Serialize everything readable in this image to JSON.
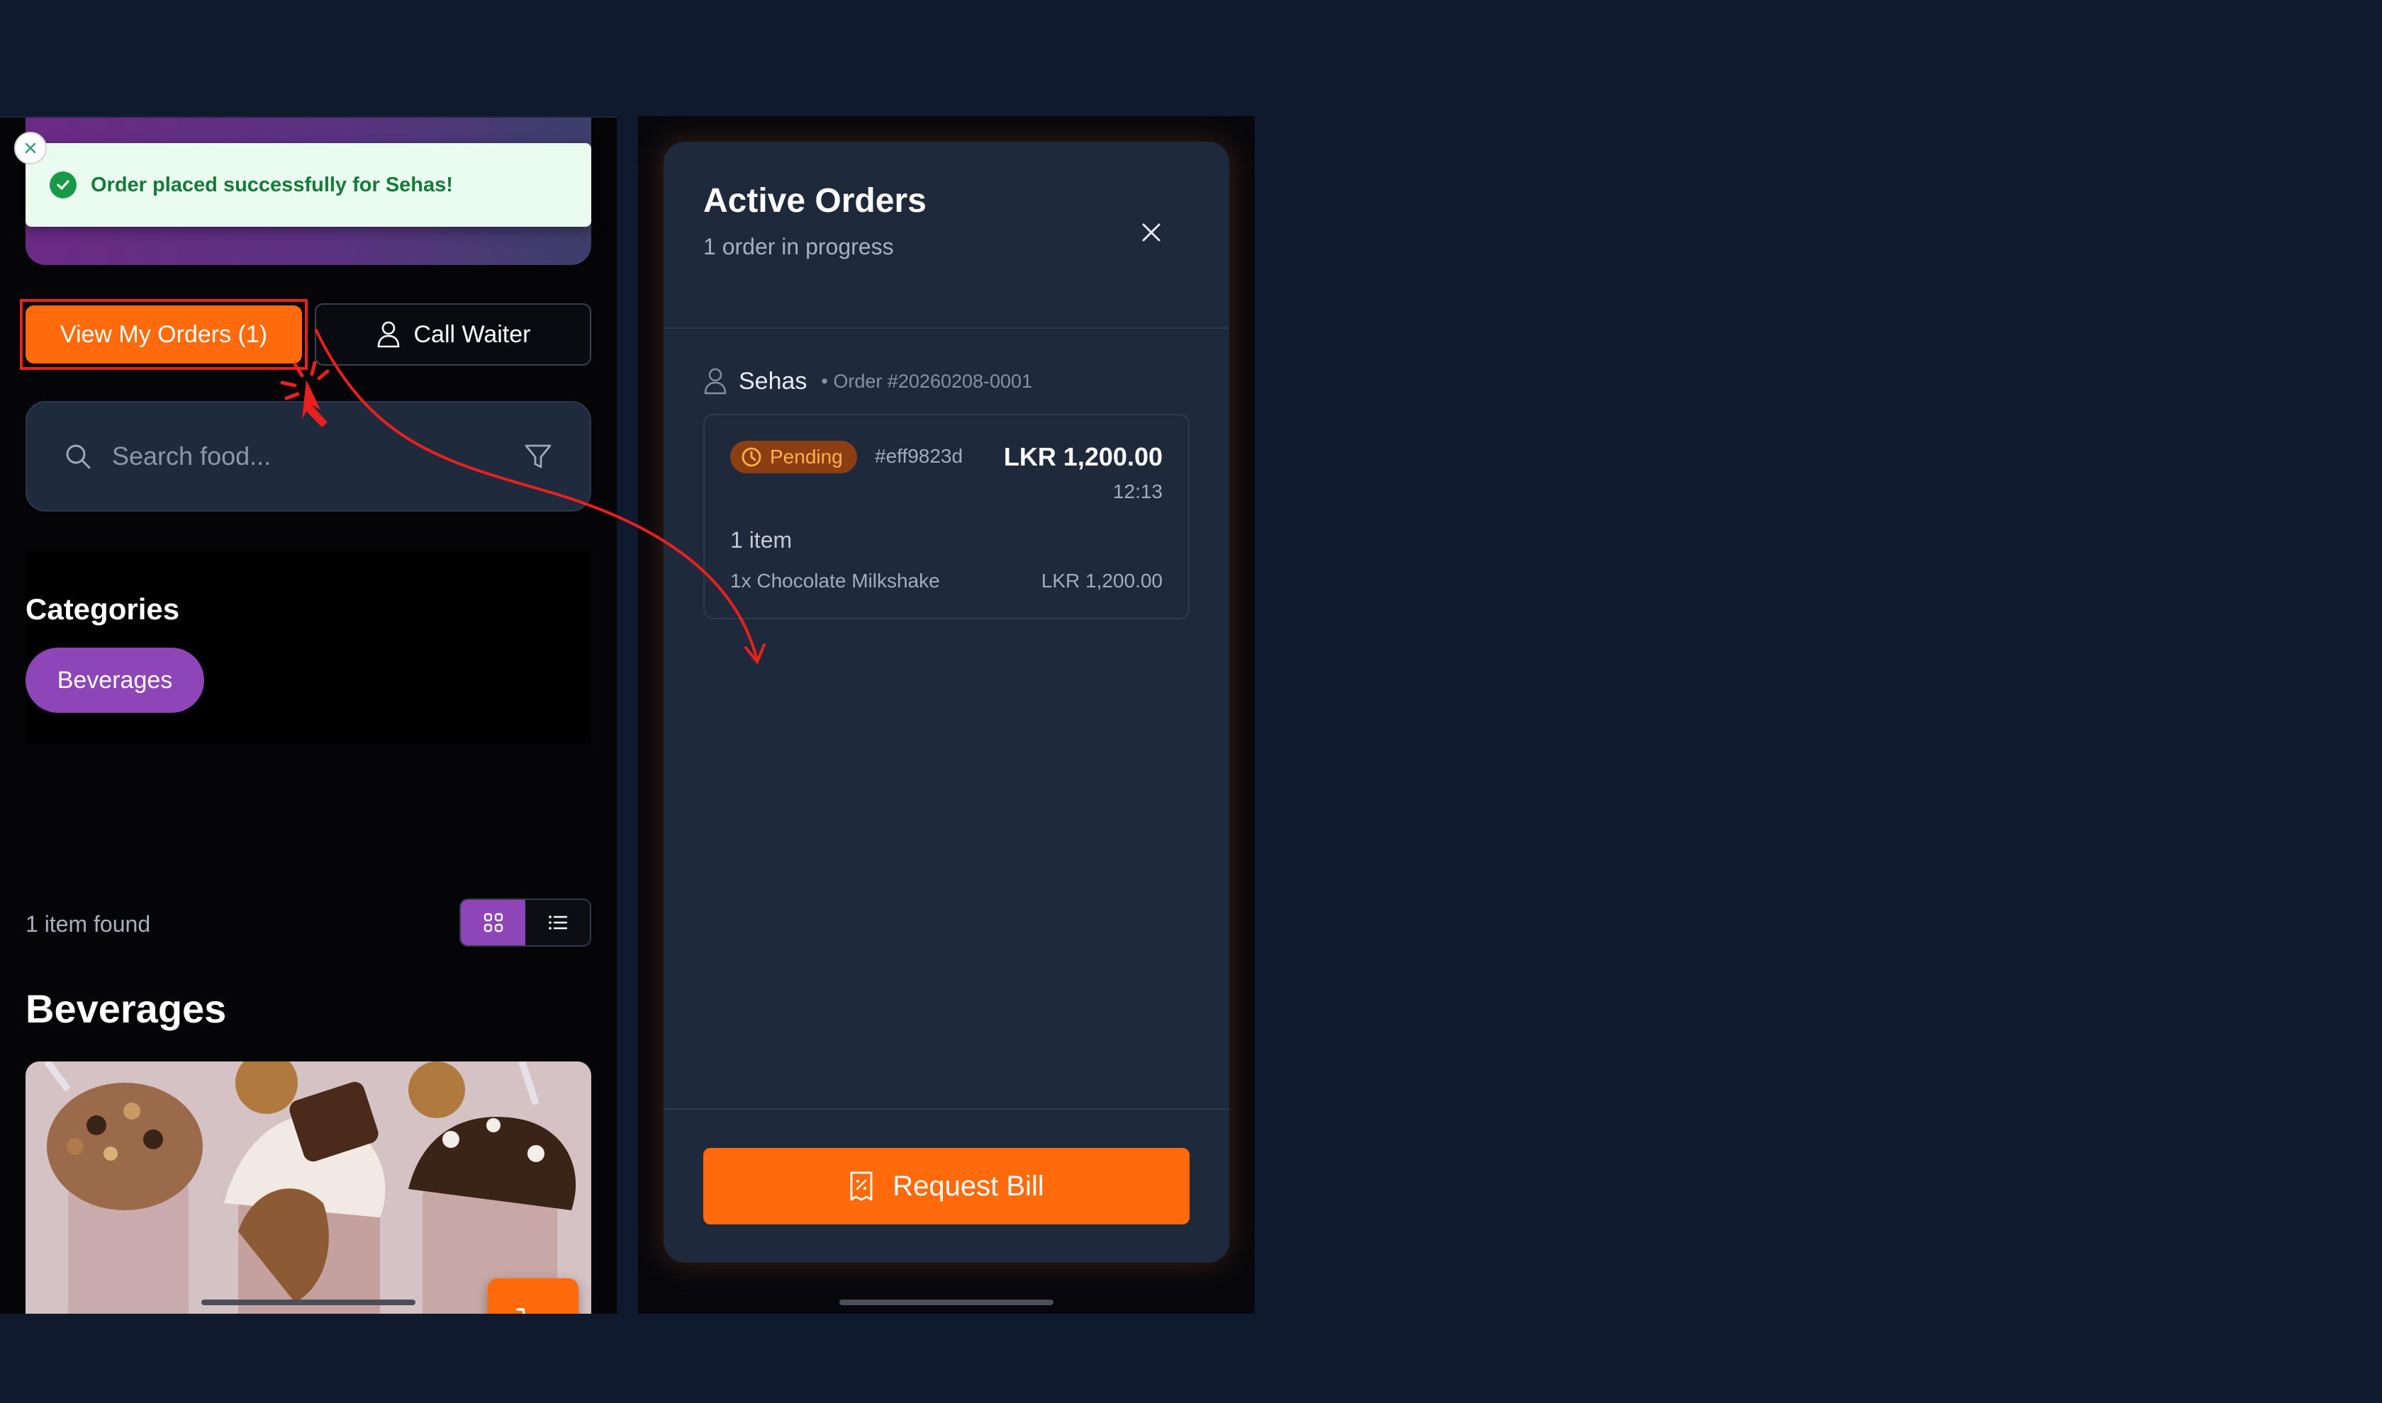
{
  "toast": {
    "message": "Order placed successfully for Sehas!"
  },
  "actions": {
    "orders_label": "View My Orders (1)",
    "waiter_label": "Call Waiter"
  },
  "search": {
    "placeholder": "Search food..."
  },
  "categories": {
    "title": "Categories",
    "chips": [
      "Beverages"
    ]
  },
  "results": {
    "count_text": "1 item found",
    "view_mode": "grid"
  },
  "section": {
    "title": "Beverages"
  },
  "modal": {
    "title": "Active Orders",
    "subtitle": "1 order in progress",
    "order": {
      "customer": "Sehas",
      "number": "• Order #20260208-0001",
      "status": "Pending",
      "hash": "#eff9823d",
      "total": "LKR 1,200.00",
      "time": "12:13",
      "item_count": "1 item",
      "items": [
        {
          "name": "1x Chocolate Milkshake",
          "price": "LKR 1,200.00"
        }
      ]
    },
    "bill_label": "Request Bill"
  },
  "colors": {
    "accent": "#ff6a0c",
    "purple": "#8e45b8",
    "success": "#169a46",
    "annotation": "#e8201e"
  }
}
